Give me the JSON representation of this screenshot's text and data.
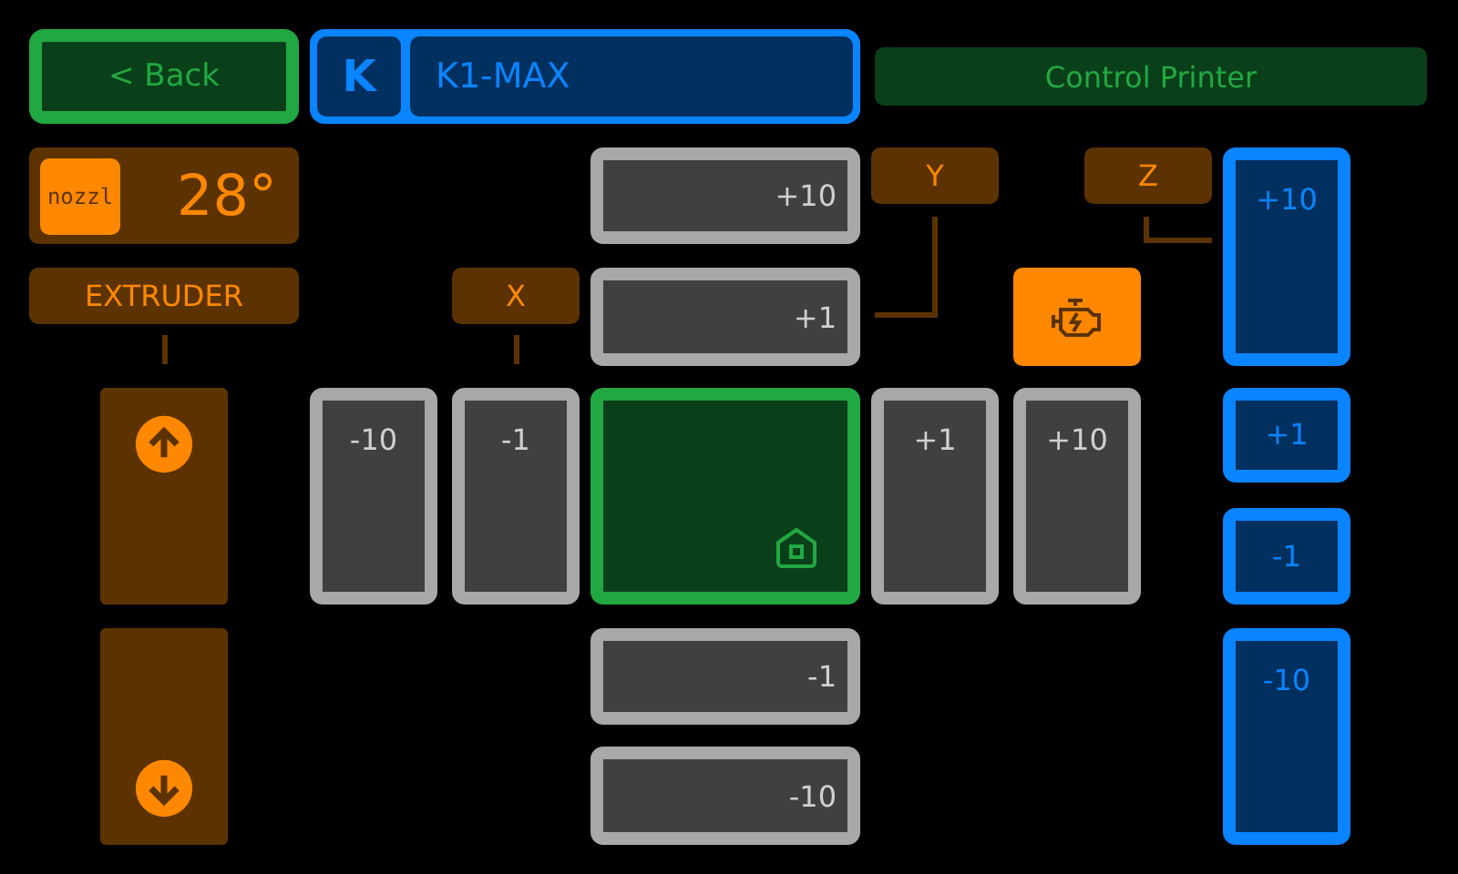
{
  "header": {
    "back": "< Back",
    "logo": "K",
    "title": "K1-MAX",
    "action": "Control Printer"
  },
  "nozzle": {
    "badge": "nozzl",
    "temperature": "28°"
  },
  "extruder": {
    "label": "EXTRUDER",
    "buttons": [
      {
        "kind": "up"
      },
      {
        "kind": "down"
      }
    ]
  },
  "x_axis": {
    "label": "X",
    "buttons": [
      "-10",
      "-1",
      "+1",
      "+10"
    ]
  },
  "y_axis": {
    "label": "Y",
    "buttons": [
      "+10",
      "+1",
      "-1",
      "-10"
    ]
  },
  "z_axis": {
    "label": "Z",
    "buttons": [
      "+10",
      "+1",
      "-1",
      "-10"
    ]
  }
}
